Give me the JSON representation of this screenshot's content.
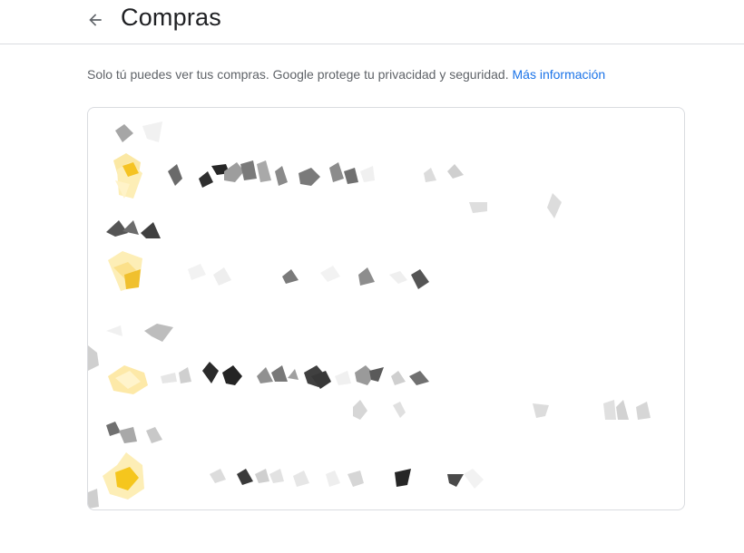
{
  "header": {
    "back_icon": "arrow-left-icon",
    "title": "Compras"
  },
  "privacy": {
    "text": "Solo tú puedes ver tus compras. Google protege tu privacidad y seguridad.",
    "link_label": "Más información"
  },
  "purchases": {
    "obscured": true,
    "group_count": 4
  },
  "colors": {
    "title": "#202124",
    "secondary_text": "#5f6368",
    "link": "#1a73e8",
    "divider": "#dadce0",
    "thumb_yellow": "#f9c715"
  }
}
